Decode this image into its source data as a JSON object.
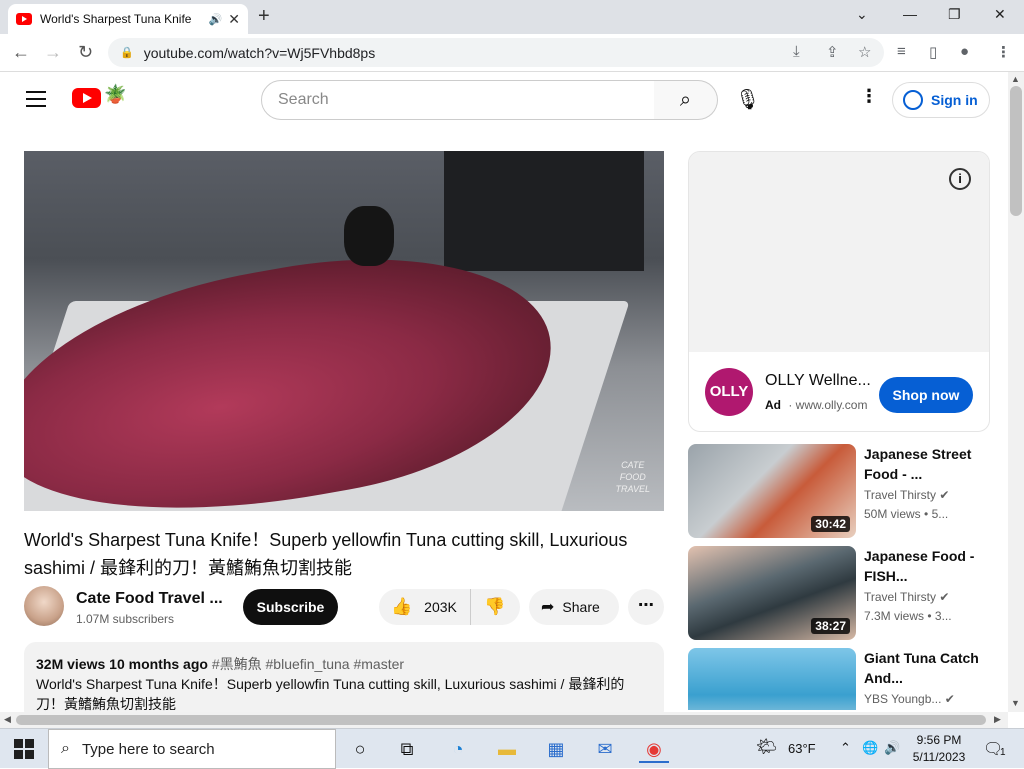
{
  "browser": {
    "tab_title": "World's Sharpest Tuna Knife",
    "tab_audio_icon": "speaker-icon",
    "tab_close": "✕",
    "new_tab": "+",
    "url": "youtube.com/watch?v=Wj5FVhbd8ps",
    "window_controls": {
      "minimize": "—",
      "maximize": "❐",
      "close": "✕",
      "tabsearch": "⌄"
    },
    "nav": {
      "back": "←",
      "forward": "→",
      "reload": "↻"
    }
  },
  "youtube": {
    "search_placeholder": "Search",
    "signin_label": "Sign in",
    "video": {
      "watermark_1": "CATE",
      "watermark_2": "FOOD",
      "watermark_3": "TRAVEL"
    },
    "title": "World's Sharpest Tuna Knife！Superb yellowfin Tuna cutting skill, Luxurious sashimi / 最鋒利的刀！黃鰭鮪魚切割技能",
    "channel": {
      "name": "Cate Food Travel ...",
      "subscribers": "1.07M subscribers",
      "subscribe_label": "Subscribe"
    },
    "actions": {
      "likes": "203K",
      "share_label": "Share",
      "more_label": "⋯"
    },
    "description": {
      "views": "32M views",
      "age": "10 months ago",
      "tags": "#黑鮪魚 #bluefin_tuna #master",
      "text": "World's Sharpest Tuna Knife！Superb yellowfin Tuna cutting skill, Luxurious sashimi / 最鋒利的刀！黃鰭鮪魚切割技能"
    },
    "ad": {
      "logo_text": "OLLY",
      "name": "OLLY Wellne...",
      "badge": "Ad",
      "url": "www.olly.com",
      "cta": "Shop now",
      "info": "i"
    },
    "recommendations": [
      {
        "title": "Japanese Street Food - ...",
        "channel": "Travel Thirsty",
        "views": "50M views",
        "extra": "• 5...",
        "duration": "30:42"
      },
      {
        "title": "Japanese Food - FISH...",
        "channel": "Travel Thirsty",
        "views": "7.3M views",
        "extra": "• 3...",
        "duration": "38:27"
      },
      {
        "title": "Giant Tuna Catch And...",
        "channel": "YBS Youngb...",
        "views": "",
        "extra": "",
        "duration": ""
      }
    ]
  },
  "taskbar": {
    "search_placeholder": "Type here to search",
    "temperature": "63°F",
    "time": "9:56 PM",
    "date": "5/11/2023",
    "notifications": "1"
  }
}
